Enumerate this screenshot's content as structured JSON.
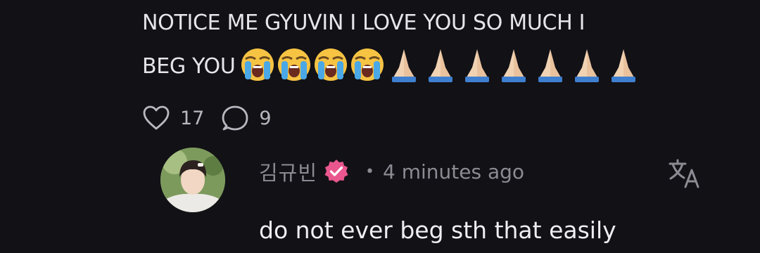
{
  "post": {
    "line1": "NOTICE ME GYUVIN I LOVE YOU SO MUCH I",
    "line2": "BEG YOU",
    "emojis": [
      "loudly-crying-face",
      "loudly-crying-face",
      "loudly-crying-face",
      "loudly-crying-face",
      "folded-hands",
      "folded-hands",
      "folded-hands",
      "folded-hands",
      "folded-hands",
      "folded-hands",
      "folded-hands"
    ]
  },
  "actions": {
    "likes": "17",
    "comments": "9"
  },
  "reply": {
    "author": "김규빈",
    "separator": "•",
    "time": "4 minutes ago",
    "text": "do not ever beg sth that easily",
    "verified_badge_color": "#e9578e"
  },
  "colors": {
    "background": "#121116",
    "text": "#e6e5ea",
    "muted": "#8c8b93"
  }
}
